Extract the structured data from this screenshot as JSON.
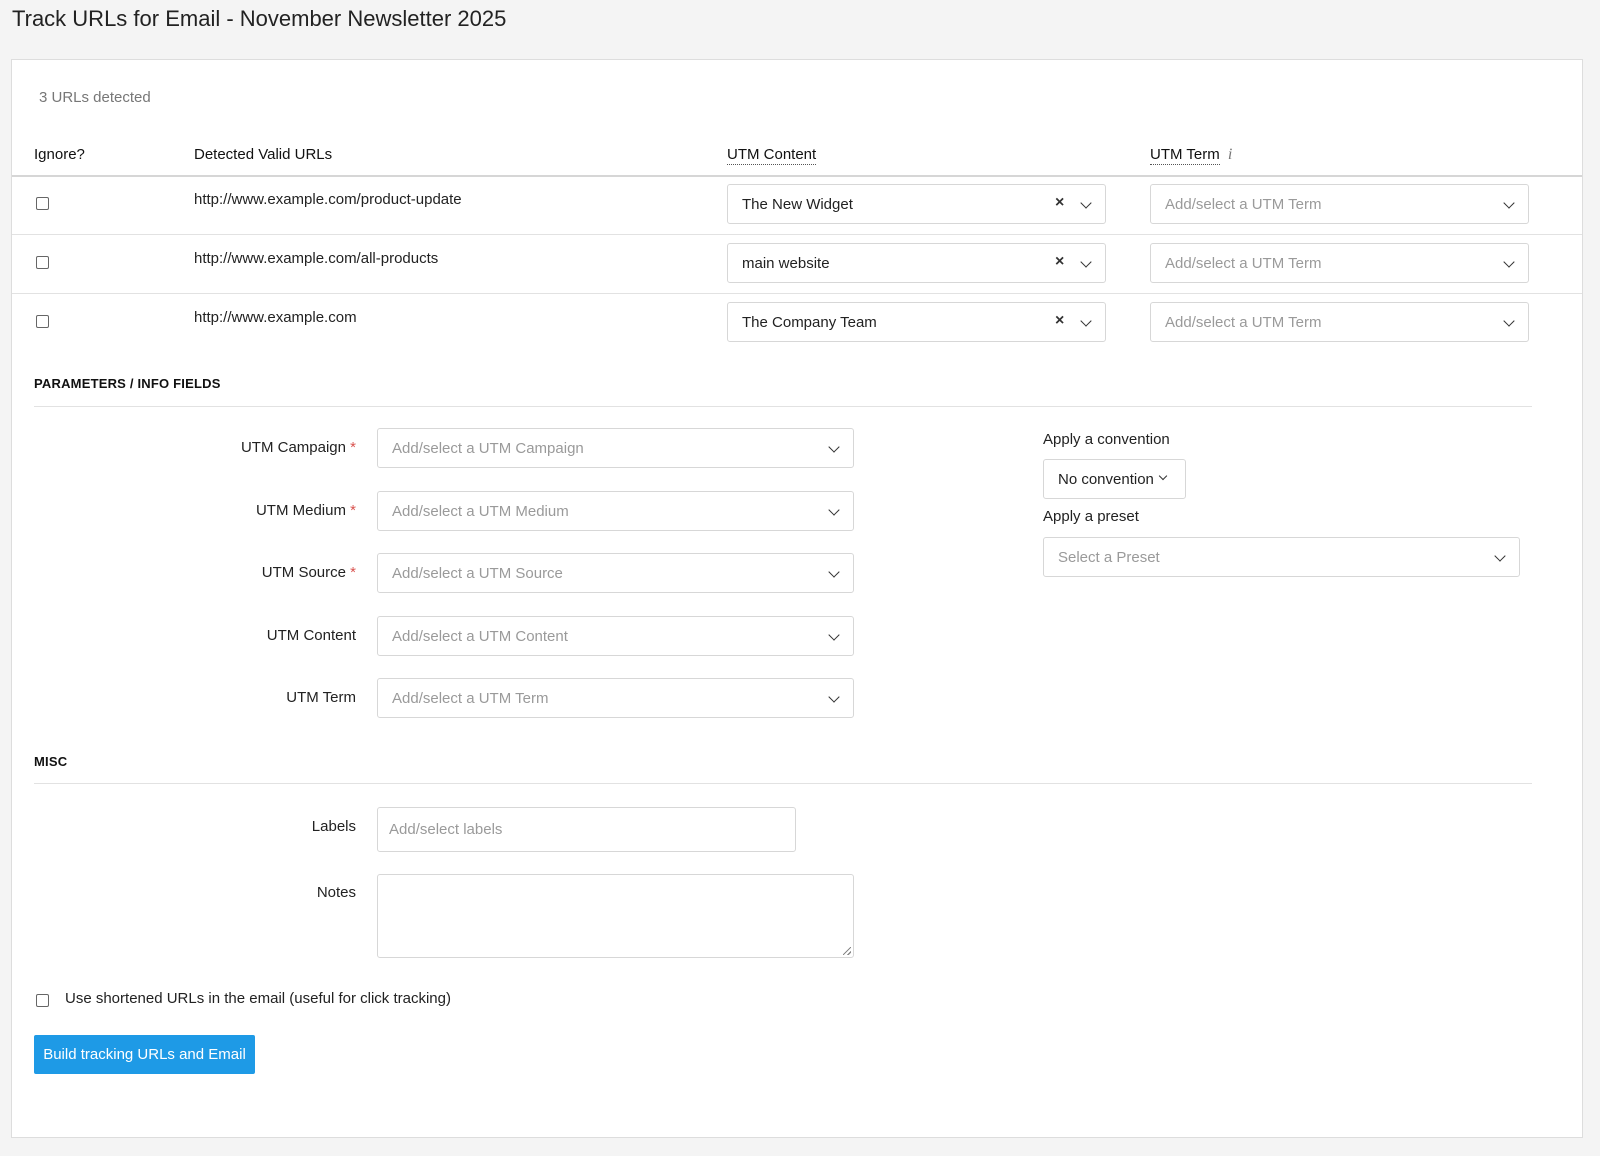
{
  "page": {
    "title": "Track URLs for Email - November Newsletter 2025"
  },
  "detected": {
    "count_text": "3 URLs detected"
  },
  "table": {
    "headers": {
      "ignore": "Ignore?",
      "urls": "Detected Valid URLs",
      "utm_content": "UTM Content",
      "utm_term": "UTM Term"
    },
    "rows": [
      {
        "url": "http://www.example.com/product-update",
        "utm_content": "The New Widget",
        "utm_term_placeholder": "Add/select a UTM Term"
      },
      {
        "url": "http://www.example.com/all-products",
        "utm_content": "main website",
        "utm_term_placeholder": "Add/select a UTM Term"
      },
      {
        "url": "http://www.example.com",
        "utm_content": "The Company Team",
        "utm_term_placeholder": "Add/select a UTM Term"
      }
    ]
  },
  "params": {
    "section_title": "PARAMETERS / INFO FIELDS",
    "campaign": {
      "label": "UTM Campaign",
      "required": "*",
      "placeholder": "Add/select a UTM Campaign"
    },
    "medium": {
      "label": "UTM Medium",
      "required": "*",
      "placeholder": "Add/select a UTM Medium"
    },
    "source": {
      "label": "UTM Source",
      "required": "*",
      "placeholder": "Add/select a UTM Source"
    },
    "content": {
      "label": "UTM Content",
      "placeholder": "Add/select a UTM Content"
    },
    "term": {
      "label": "UTM Term",
      "placeholder": "Add/select a UTM Term"
    },
    "convention": {
      "label": "Apply a convention",
      "value": "No convention"
    },
    "preset": {
      "label": "Apply a preset",
      "placeholder": "Select a Preset"
    }
  },
  "misc": {
    "section_title": "MISC",
    "labels": {
      "label": "Labels",
      "placeholder": "Add/select labels"
    },
    "notes": {
      "label": "Notes"
    },
    "shortened_label": "Use shortened URLs in the email (useful for click tracking)",
    "build_button": "Build tracking URLs and Email"
  },
  "colors": {
    "primary_button": "#1e9ae6",
    "required_star": "#d9534f"
  },
  "icons": {
    "info": "info-icon",
    "clear": "clear-x-icon",
    "dropdown": "chevron-down-icon"
  }
}
